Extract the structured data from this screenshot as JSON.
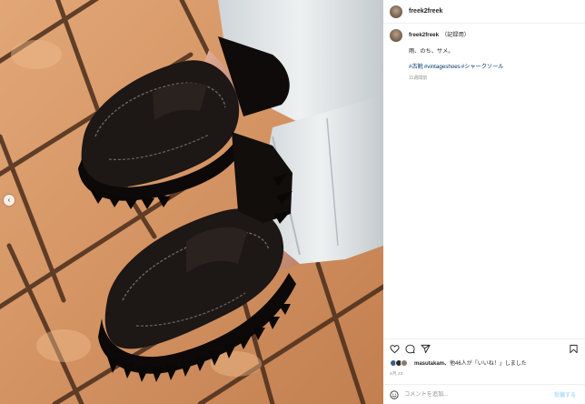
{
  "post": {
    "author": "freek2freek",
    "caption_header": "（記録用）",
    "caption_text": "雨、のち、サメ。",
    "hashtags": [
      "#古靴",
      "#vintageshoes",
      "#シャークソール"
    ],
    "time_ago": "11週間前",
    "likes_users": "masutakam、",
    "likes_text": "他46人が「いいね！」しました",
    "date": "4月 23",
    "comment_placeholder": "コメントを追加...",
    "post_button": "投稿する"
  },
  "icons": {
    "like": "heart-icon",
    "comment": "comment-icon",
    "share": "share-icon",
    "save": "bookmark-icon",
    "emoji": "emoji-icon",
    "carousel": "chevron-left-icon"
  },
  "colors": {
    "link": "#00376b",
    "muted": "#8e8e8e",
    "post_button": "#b2dffc"
  }
}
